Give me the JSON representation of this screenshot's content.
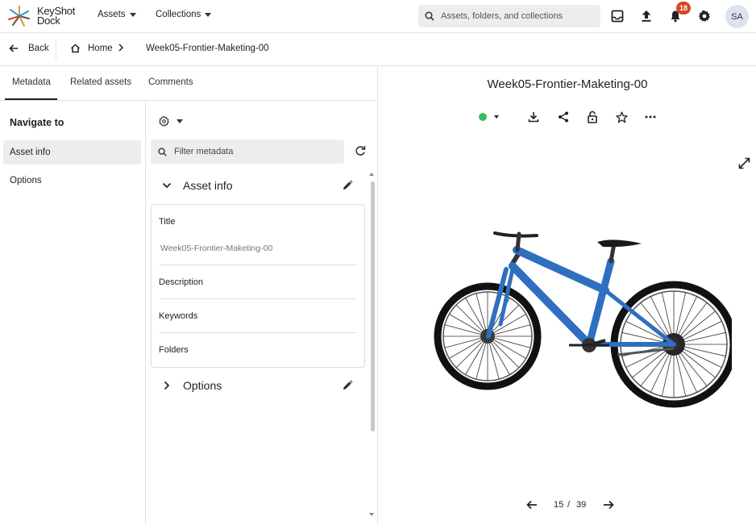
{
  "app": {
    "logo_text": "KeyShot Dock"
  },
  "topnav": {
    "assets_label": "Assets",
    "collections_label": "Collections",
    "search_placeholder": "Assets, folders, and collections",
    "notification_count": "18",
    "avatar_initials": "SA"
  },
  "breadcrumb": {
    "back_label": "Back",
    "home_label": "Home",
    "current": "Week05-Frontier-Maketing-00"
  },
  "tabs": [
    "Metadata",
    "Related assets",
    "Comments"
  ],
  "sidebar": {
    "heading": "Navigate to",
    "items": [
      {
        "label": "Asset info",
        "active": true
      },
      {
        "label": "Options",
        "active": false
      }
    ]
  },
  "metadata": {
    "filter_placeholder": "Filter metadata",
    "sections": [
      {
        "title": "Asset info",
        "expanded": true
      },
      {
        "title": "Options",
        "expanded": false
      }
    ],
    "fields": [
      {
        "label": "Title",
        "value": "Week05-Frontier-Maketing-00"
      },
      {
        "label": "Description",
        "value": ""
      },
      {
        "label": "Keywords",
        "value": ""
      },
      {
        "label": "Folders",
        "value": ""
      }
    ]
  },
  "viewer": {
    "title": "Week05-Frontier-Maketing-00",
    "status_color": "#3dba5a",
    "current_page": "15",
    "separator": "/",
    "total_pages": "39",
    "image_subject": "blue-mountain-bike"
  },
  "colors": {
    "badge": "#d64624",
    "bike_frame": "#2f6fc0"
  }
}
